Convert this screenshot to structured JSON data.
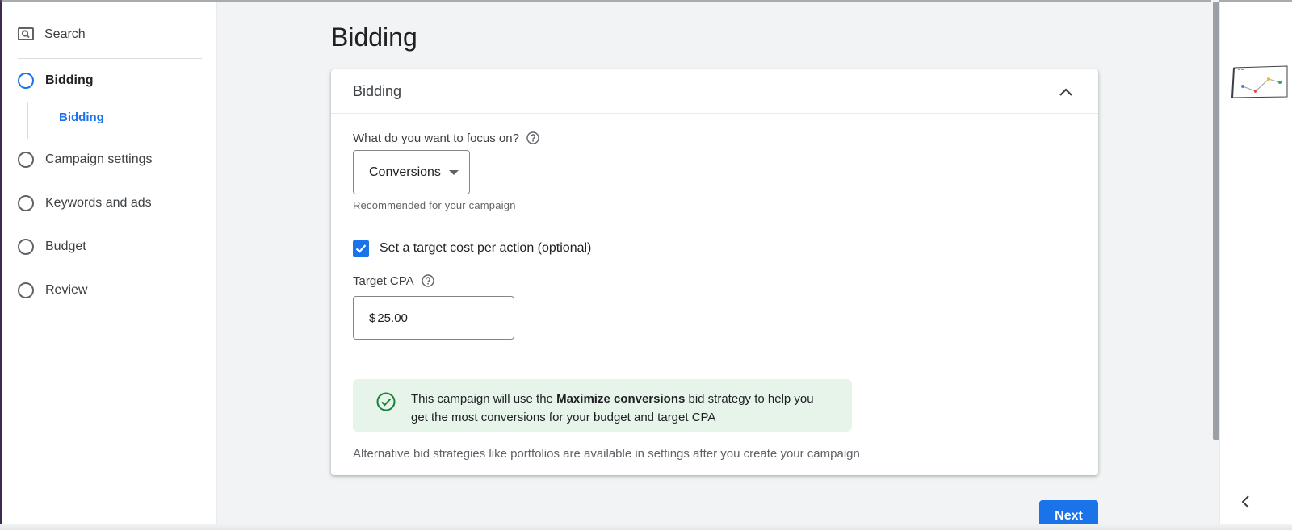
{
  "sidebar": {
    "search_label": "Search",
    "steps": [
      {
        "label": "Bidding",
        "active": true
      },
      {
        "label": "Campaign settings",
        "active": false
      },
      {
        "label": "Keywords and ads",
        "active": false
      },
      {
        "label": "Budget",
        "active": false
      },
      {
        "label": "Review",
        "active": false
      }
    ],
    "substep_label": "Bidding"
  },
  "page": {
    "title": "Bidding"
  },
  "card": {
    "title": "Bidding",
    "focus_question": "What do you want to focus on?",
    "focus_value": "Conversions",
    "focus_hint": "Recommended for your campaign",
    "target_checkbox_label": "Set a target cost per action (optional)",
    "target_checkbox_checked": true,
    "target_cpa_label": "Target CPA",
    "target_cpa_currency": "$",
    "target_cpa_value": "25.00",
    "notice_prefix": "This campaign will use the ",
    "notice_bold": "Maximize conversions",
    "notice_suffix": " bid strategy to help you get the most conversions for your budget and target CPA",
    "footnote": "Alternative bid strategies like portfolios are available in settings after you create your campaign"
  },
  "actions": {
    "next_label": "Next"
  },
  "colors": {
    "accent": "#1a73e8",
    "success_bg": "#e6f4ea",
    "success_icon": "#188038"
  },
  "icons": {
    "search": "search-icon",
    "help": "help-circle-icon",
    "collapse": "chevron-up-icon",
    "success": "check-circle-icon",
    "back": "chevron-left-icon"
  }
}
